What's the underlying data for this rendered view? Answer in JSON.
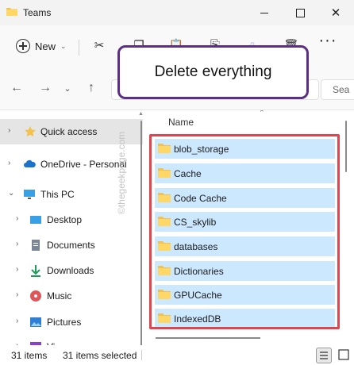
{
  "window": {
    "title": "Teams",
    "minimize_icon": "minimize-icon",
    "maximize_icon": "maximize-icon",
    "close_icon": "close-icon"
  },
  "toolbar": {
    "new_label": "New",
    "more_label": "···"
  },
  "search": {
    "placeholder": "Sea"
  },
  "tooltip": {
    "text": "Delete everything",
    "border_color": "#5c2e86"
  },
  "nav_pane": {
    "items": [
      {
        "label": "Quick access",
        "icon": "star-icon"
      },
      {
        "label": "OneDrive - Personal",
        "icon": "cloud-icon"
      },
      {
        "label": "This PC",
        "icon": "monitor-icon"
      },
      {
        "label": "Desktop",
        "icon": "desktop-icon"
      },
      {
        "label": "Documents",
        "icon": "documents-icon"
      },
      {
        "label": "Downloads",
        "icon": "download-arrow-icon"
      },
      {
        "label": "Music",
        "icon": "music-icon"
      },
      {
        "label": "Pictures",
        "icon": "pictures-icon"
      },
      {
        "label": "Vi",
        "icon": "videos-icon"
      }
    ]
  },
  "content": {
    "column_name": "Name",
    "selection_border_color": "#e0444e",
    "selection_fill_color": "#cce8ff",
    "files": [
      {
        "name": "blob_storage"
      },
      {
        "name": "Cache"
      },
      {
        "name": "Code Cache"
      },
      {
        "name": "CS_skylib"
      },
      {
        "name": "databases"
      },
      {
        "name": "Dictionaries"
      },
      {
        "name": "GPUCache"
      },
      {
        "name": "IndexedDB"
      }
    ]
  },
  "status": {
    "items_count": "31 items",
    "selected_count": "31 items selected"
  },
  "watermark": "©thegeekpage.com"
}
